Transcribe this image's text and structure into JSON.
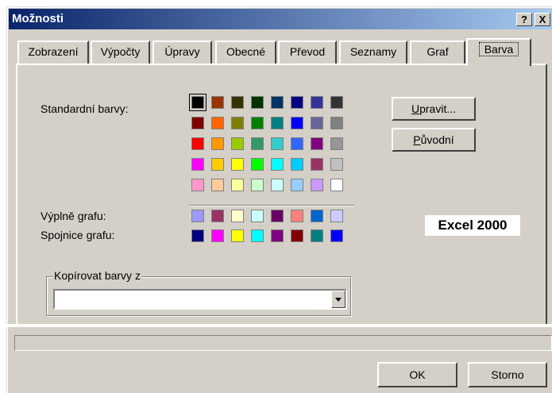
{
  "window": {
    "title": "Možnosti",
    "help_button": "?",
    "close_button": "X"
  },
  "tabs": [
    {
      "label": "Zobrazení"
    },
    {
      "label": "Výpočty"
    },
    {
      "label": "Úpravy"
    },
    {
      "label": "Obecné"
    },
    {
      "label": "Převod"
    },
    {
      "label": "Seznamy"
    },
    {
      "label": "Graf"
    },
    {
      "label": "Barva"
    }
  ],
  "active_tab": "Barva",
  "labels": {
    "standard_colors": "Standardní barvy:",
    "chart_fills": "Výplně grafu:",
    "chart_lines": "Spojnice grafu:",
    "copy_colors_from": "Kopírovat barvy z"
  },
  "buttons": {
    "modify_prefix": "",
    "modify_ul": "U",
    "modify_rest": "pravit...",
    "reset_prefix": "",
    "reset_ul": "P",
    "reset_rest": "ůvodní",
    "ok": "OK",
    "cancel": "Storno"
  },
  "overlay_label": "Excel 2000",
  "copy_from": {
    "value": ""
  },
  "palette": {
    "standard": [
      [
        "#000000",
        "#993300",
        "#333300",
        "#003300",
        "#003366",
        "#000080",
        "#333399",
        "#333333"
      ],
      [
        "#800000",
        "#ff6600",
        "#808000",
        "#008000",
        "#008080",
        "#0000ff",
        "#666699",
        "#808080"
      ],
      [
        "#ff0000",
        "#ff9900",
        "#99cc00",
        "#339966",
        "#33cccc",
        "#3366ff",
        "#800080",
        "#969696"
      ],
      [
        "#ff00ff",
        "#ffcc00",
        "#ffff00",
        "#00ff00",
        "#00ffff",
        "#00ccff",
        "#993366",
        "#c0c0c0"
      ],
      [
        "#ff99cc",
        "#ffcc99",
        "#ffff99",
        "#ccffcc",
        "#ccffff",
        "#99ccff",
        "#cc99ff",
        "#ffffff"
      ]
    ],
    "chart_fills": [
      "#9999ff",
      "#993366",
      "#ffffcc",
      "#ccffff",
      "#660066",
      "#ff8080",
      "#0066cc",
      "#ccccff"
    ],
    "chart_lines": [
      "#000080",
      "#ff00ff",
      "#ffff00",
      "#00ffff",
      "#800080",
      "#800000",
      "#008080",
      "#0000ff"
    ]
  }
}
